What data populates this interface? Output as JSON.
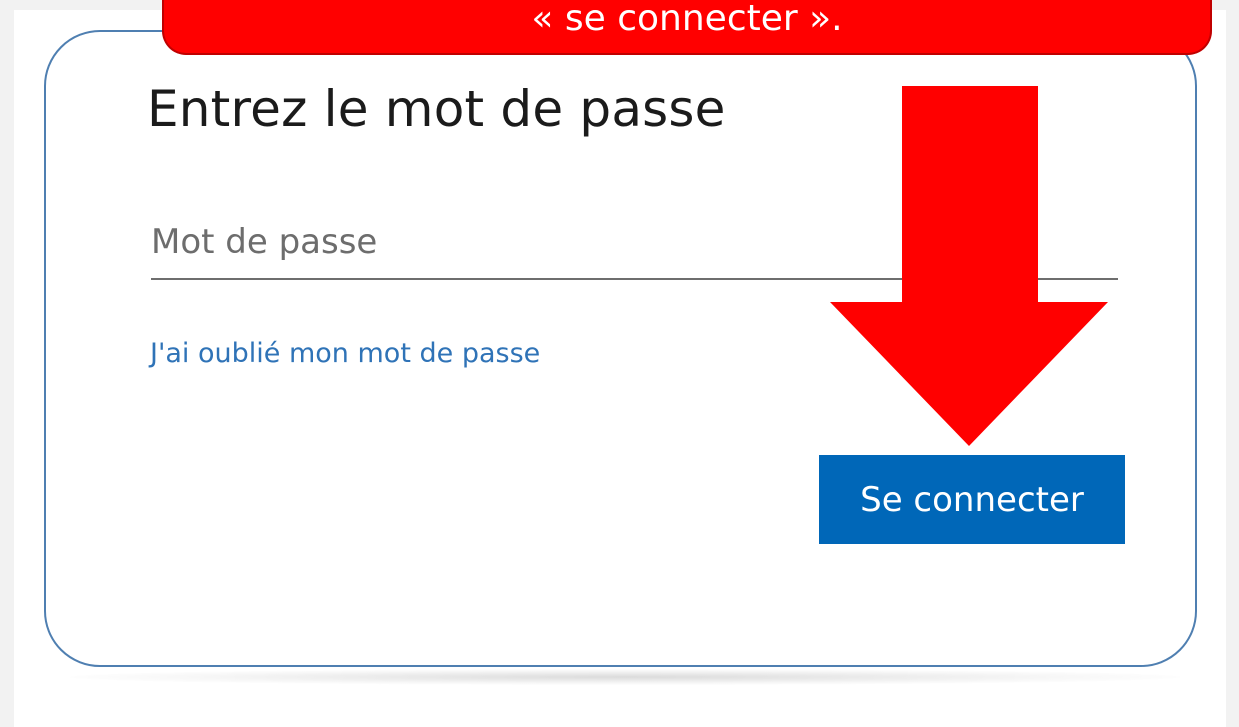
{
  "callout": {
    "text": "« se connecter »."
  },
  "login": {
    "title": "Entrez le mot de passe",
    "password": {
      "value": "",
      "placeholder": "Mot de passe"
    },
    "forgot_link": "J'ai oublié mon mot de passe",
    "signin_button": "Se connecter"
  },
  "colors": {
    "accent": "#0067b8",
    "link": "#2f73b7",
    "annotation": "#ff0000",
    "card_border": "#4f7fb1"
  },
  "icons": {
    "annotation_arrow": "down-arrow-icon"
  }
}
